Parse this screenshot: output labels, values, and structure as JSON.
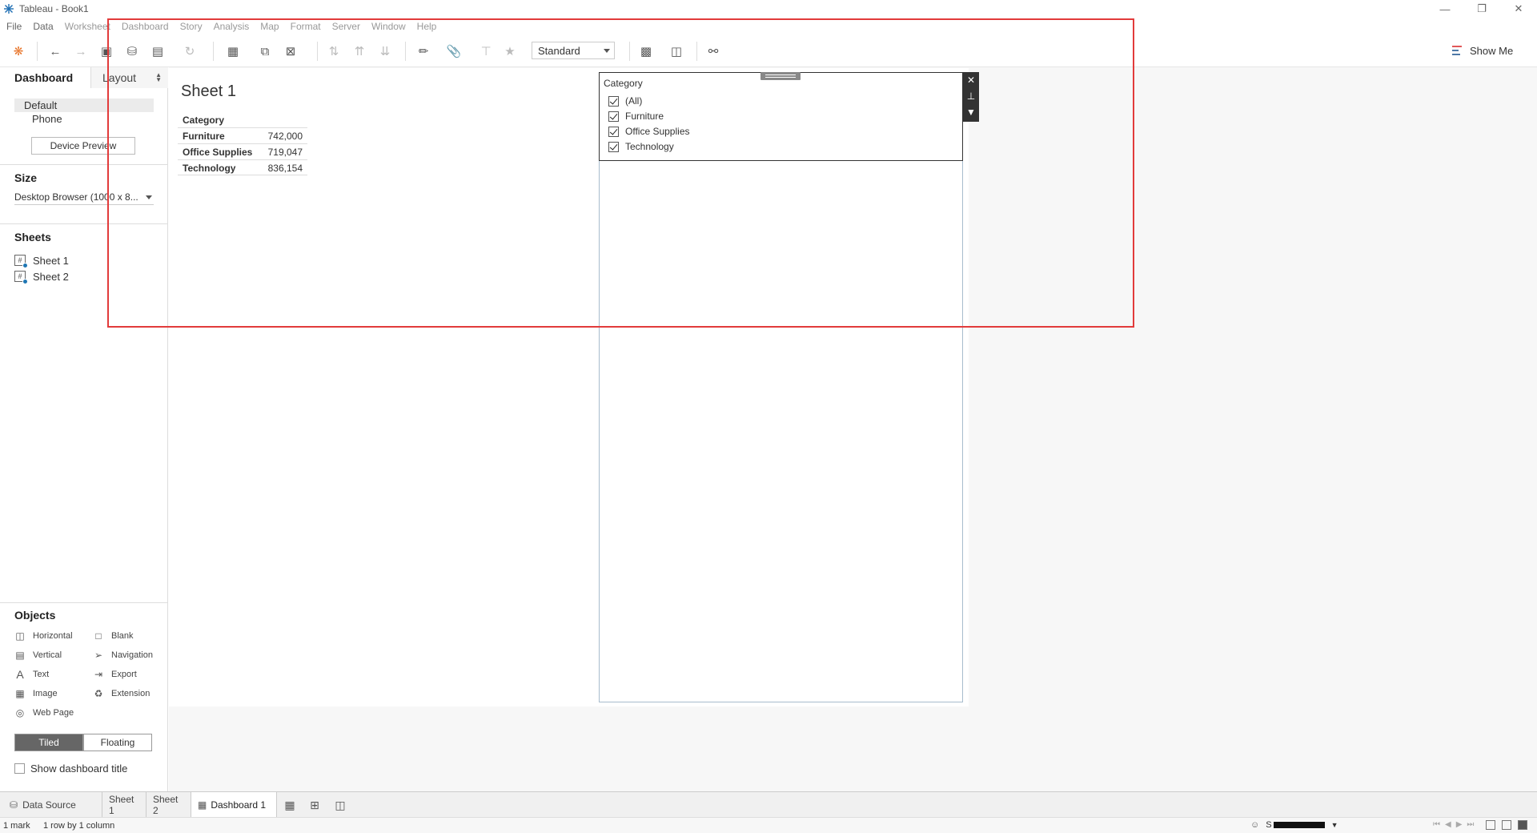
{
  "window": {
    "title": "Tableau - Book1",
    "controls": [
      "minimize",
      "restore",
      "close"
    ]
  },
  "menu": [
    "File",
    "Data",
    "Worksheet",
    "Dashboard",
    "Story",
    "Analysis",
    "Map",
    "Format",
    "Server",
    "Window",
    "Help"
  ],
  "toolbar": {
    "fit_select": "Standard",
    "show_me": "Show Me"
  },
  "left_panel": {
    "tabs": {
      "dashboard": "Dashboard",
      "layout": "Layout"
    },
    "devices": {
      "default": "Default",
      "phone": "Phone"
    },
    "device_preview": "Device Preview",
    "size_heading": "Size",
    "size_value": "Desktop Browser (1000 x 8...",
    "sheets_heading": "Sheets",
    "sheets": [
      "Sheet 1",
      "Sheet 2"
    ],
    "objects_heading": "Objects",
    "objects": {
      "horizontal": "Horizontal",
      "blank": "Blank",
      "vertical": "Vertical",
      "navigation": "Navigation",
      "text": "Text",
      "export": "Export",
      "image": "Image",
      "extension": "Extension",
      "web_page": "Web Page"
    },
    "tiled": "Tiled",
    "floating": "Floating",
    "show_dashboard_title": "Show dashboard title"
  },
  "dashboard": {
    "sheet_title": "Sheet 1",
    "table": {
      "header": "Category",
      "rows": [
        {
          "category": "Furniture",
          "value": "742,000"
        },
        {
          "category": "Office Supplies",
          "value": "719,047"
        },
        {
          "category": "Technology",
          "value": "836,154"
        }
      ]
    },
    "filter": {
      "title": "Category",
      "items": [
        "(All)",
        "Furniture",
        "Office Supplies",
        "Technology"
      ]
    }
  },
  "bottom_tabs": {
    "data_source": "Data Source",
    "sheet1": "Sheet 1",
    "sheet2": "Sheet 2",
    "dashboard1": "Dashboard 1"
  },
  "status": {
    "marks": "1 mark",
    "rows_cols": "1 row by 1 column",
    "user_prefix": "S"
  },
  "colors": {
    "annotation_red": "#e23b3b",
    "accent_blue": "#1f77b4"
  }
}
